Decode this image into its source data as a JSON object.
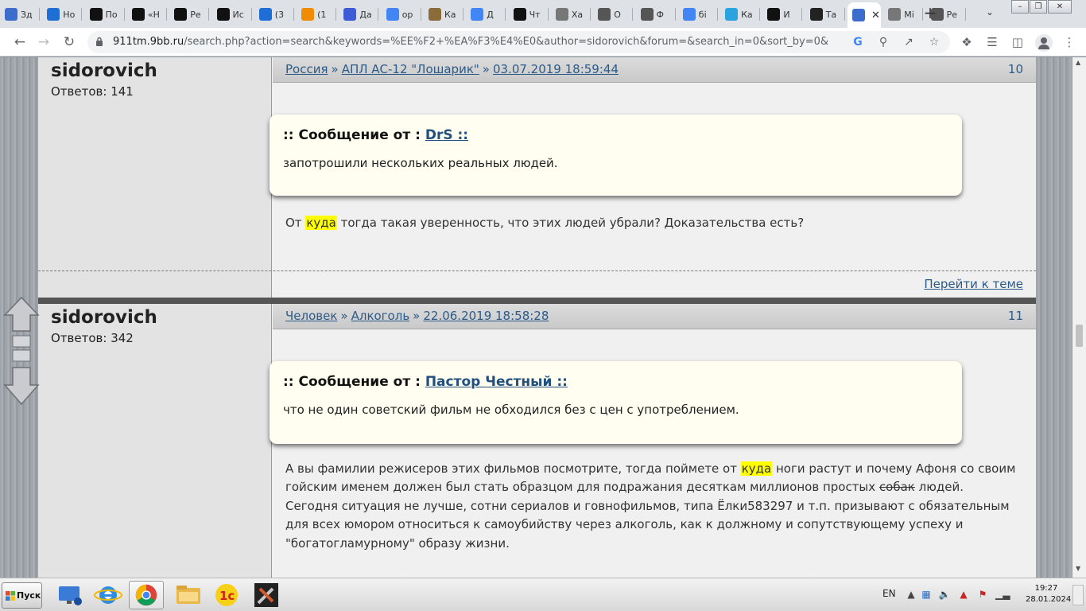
{
  "browser": {
    "tabs": [
      {
        "label": "Зд",
        "icon": "site-logo-icon",
        "color": "#3d6dcc"
      },
      {
        "label": "Но",
        "icon": "mail-at-icon",
        "color": "#1e6ed6"
      },
      {
        "label": "По",
        "icon": "black-circle-plus-icon",
        "color": "#111111"
      },
      {
        "label": "«Н",
        "icon": "black-circle-plus-icon",
        "color": "#111111"
      },
      {
        "label": "Ре",
        "icon": "black-circle-plus-icon",
        "color": "#111111"
      },
      {
        "label": "Ис",
        "icon": "black-circle-plus-icon",
        "color": "#111111"
      },
      {
        "label": "(3",
        "icon": "envelope-icon",
        "color": "#1e6ed6"
      },
      {
        "label": "(1",
        "icon": "ok-icon",
        "color": "#f08c00"
      },
      {
        "label": "Да",
        "icon": "bookmark-doc-icon",
        "color": "#3d5bd6"
      },
      {
        "label": "ор",
        "icon": "google-icon",
        "color": "#4285f4"
      },
      {
        "label": "Ка",
        "icon": "k-icon",
        "color": "#8b6b3a"
      },
      {
        "label": "Д",
        "icon": "google-icon",
        "color": "#4285f4"
      },
      {
        "label": "Чт",
        "icon": "black-circle-plus-icon",
        "color": "#111111"
      },
      {
        "label": "Ха",
        "icon": "site-emblem-icon",
        "color": "#777777"
      },
      {
        "label": "О",
        "icon": "globe-icon",
        "color": "#555555"
      },
      {
        "label": "Ф",
        "icon": "globe-icon",
        "color": "#555555"
      },
      {
        "label": "бі",
        "icon": "google-icon",
        "color": "#4285f4"
      },
      {
        "label": "Ка",
        "icon": "telegram-icon",
        "color": "#2aa3e0"
      },
      {
        "label": "И",
        "icon": "bk-icon",
        "color": "#111111"
      },
      {
        "label": "Та",
        "icon": "bird-icon",
        "color": "#222222"
      },
      {
        "label": "",
        "icon": "site-logo-icon",
        "color": "#3d6dcc",
        "active": true
      },
      {
        "label": "Мі",
        "icon": "site-emblem-icon",
        "color": "#777777"
      },
      {
        "label": "Ре",
        "icon": "globe-icon",
        "color": "#555555"
      }
    ],
    "url_host": "911tm.9bb.ru",
    "url_rest": "/search.php?action=search&keywords=%EE%F2+%EA%F3%E4%E0&author=sidorovich&forum=&search_in=0&sort_by=0&sort_dir..."
  },
  "posts": [
    {
      "author": "sidorovich",
      "replies": "Ответов: 141",
      "crumbs": [
        "Россия",
        "АПЛ АС-12 \"Лошарик\"",
        "03.07.2019 18:59:44"
      ],
      "number": "10",
      "quote_prefix": ":: Сообщение от :",
      "quote_author": "DrS ::",
      "quote_text": "запотрошили нескольких реальных людей.",
      "text_parts": [
        "От ",
        "куда",
        " тогда такая уверенность, что этих людей убрали? Доказательства есть?"
      ],
      "goto_label": "Перейти к теме"
    },
    {
      "author": "sidorovich",
      "replies": "Ответов: 342",
      "crumbs": [
        "Человек",
        "Алкоголь",
        "22.06.2019 18:58:28"
      ],
      "number": "11",
      "quote_prefix": ":: Сообщение от :",
      "quote_author": "Пастор Честный ::",
      "quote_text": "что не один советский фильм не обходился без с цен с употреблением.",
      "lines": [
        [
          "А вы фамилии режисеров этих фильмов посмотрите, тогда поймете от ",
          "куда",
          " ноги растут и почему Афоня со своим"
        ],
        [
          "гойским именем должен был стать образцом для подражания десяткам миллионов простых ",
          "собак",
          " людей."
        ],
        [
          "Сегодня ситуация не лучше, сотни сериалов и говнофильмов, типа Ёлки583297 и т.п. призывают с обязательным"
        ],
        [
          "для всех юмором относиться к самоубийству через алкоголь, как к должному и сопутствующему успеху и"
        ],
        [
          "\"богатогламурному\" образу жизни."
        ]
      ]
    }
  ],
  "taskbar": {
    "start_label": "Пуск",
    "lang": "EN",
    "time": "19:27",
    "date": "28.01.2024"
  },
  "colors": {
    "link": "#2b5b8a",
    "highlight": "#ffff00",
    "quote_bg": "#fffef0"
  }
}
